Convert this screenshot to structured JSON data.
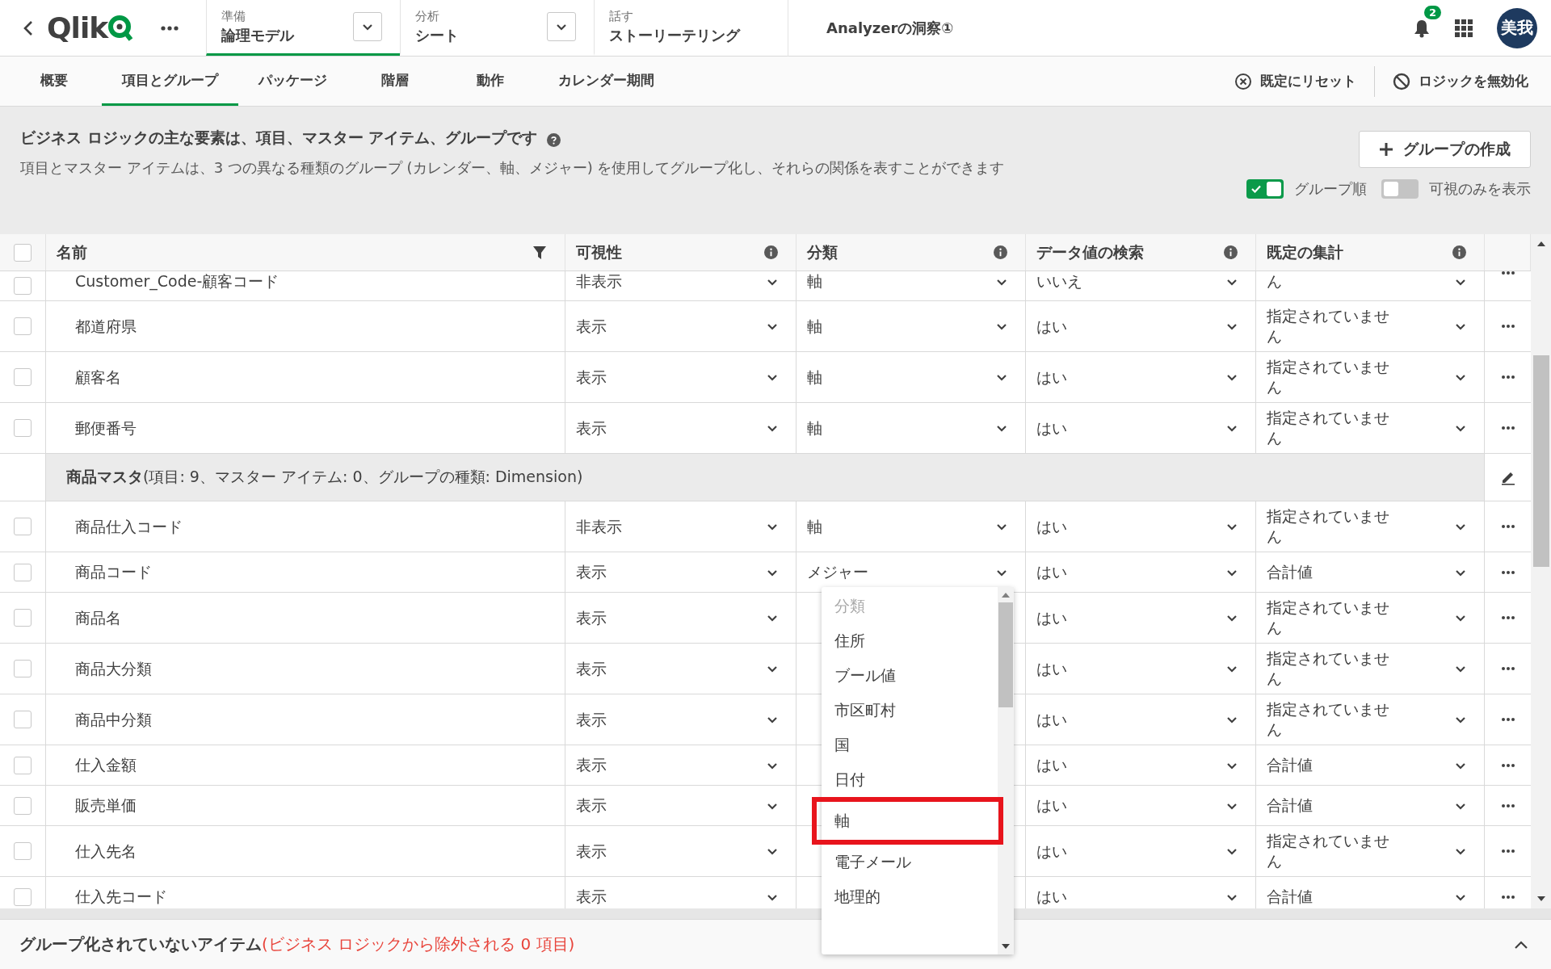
{
  "topbar": {
    "logo": "Qlik",
    "nav": [
      {
        "label": "準備",
        "value": "論理モデル",
        "selected": true,
        "has_dropdown": true
      },
      {
        "label": "分析",
        "value": "シート",
        "selected": false,
        "has_dropdown": true
      },
      {
        "label": "話す",
        "value": "ストーリーテリング",
        "selected": false,
        "has_dropdown": false
      }
    ],
    "app_title": "Analyzerの洞察①",
    "notification_count": "2",
    "avatar": "美我"
  },
  "tabs": [
    {
      "label": "概要",
      "selected": false
    },
    {
      "label": "項目とグループ",
      "selected": true
    },
    {
      "label": "パッケージ",
      "selected": false
    },
    {
      "label": "階層",
      "selected": false
    },
    {
      "label": "動作",
      "selected": false
    },
    {
      "label": "カレンダー期間",
      "selected": false
    }
  ],
  "actions": [
    {
      "label": "既定にリセット",
      "kind": "reset"
    },
    {
      "label": "ロジックを無効化",
      "kind": "disable"
    }
  ],
  "intro": {
    "heading": "ビジネス ロジックの主な要素は、項目、マスター アイテム、グループです",
    "description": "項目とマスター アイテムは、3 つの異なる種類のグループ (カレンダー、軸、メジャー) を使用してグループ化し、それらの関係を表すことができます"
  },
  "create_group_button": "グループの作成",
  "toggles": [
    {
      "label": "グループ順",
      "on": true
    },
    {
      "label": "可視のみを表示",
      "on": false
    }
  ],
  "table": {
    "all_checked": false,
    "columns": [
      {
        "label": "名前",
        "kind": "filter"
      },
      {
        "label": "可視性",
        "kind": "info"
      },
      {
        "label": "分類",
        "kind": "info"
      },
      {
        "label": "データ値の検索",
        "kind": "info"
      },
      {
        "label": "既定の集計",
        "kind": "info"
      }
    ],
    "rows": [
      {
        "kind": "clipped",
        "checked": false,
        "name": "Customer_Code-顧客コード",
        "visibility": "非表示",
        "classification": "軸",
        "search": "いいえ",
        "aggregation": "ん"
      },
      {
        "kind": "item",
        "checked": false,
        "name": "都道府県",
        "visibility": "表示",
        "classification": "軸",
        "search": "はい",
        "aggregation": "指定されていません"
      },
      {
        "kind": "item",
        "checked": false,
        "name": "顧客名",
        "visibility": "表示",
        "classification": "軸",
        "search": "はい",
        "aggregation": "指定されていません"
      },
      {
        "kind": "item",
        "checked": false,
        "name": "郵便番号",
        "visibility": "表示",
        "classification": "軸",
        "search": "はい",
        "aggregation": "指定されていません"
      },
      {
        "kind": "group",
        "title": "**商品マスタ**(項目: 9、マスター アイテム: 0、グループの種類: Dimension)"
      },
      {
        "kind": "item",
        "checked": false,
        "name": "商品仕入コード",
        "visibility": "非表示",
        "classification": "軸",
        "search": "はい",
        "aggregation": "指定されていません"
      },
      {
        "kind": "item",
        "checked": false,
        "name": "商品コード",
        "visibility": "表示",
        "classification": "メジャー",
        "search": "はい",
        "aggregation": "合計値"
      },
      {
        "kind": "item",
        "checked": false,
        "name": "商品名",
        "visibility": "表示",
        "search": "はい",
        "aggregation": "指定されていません"
      },
      {
        "kind": "item",
        "checked": false,
        "name": "商品大分類",
        "visibility": "表示",
        "search": "はい",
        "aggregation": "指定されていません"
      },
      {
        "kind": "item",
        "checked": false,
        "name": "商品中分類",
        "visibility": "表示",
        "search": "はい",
        "aggregation": "指定されていません"
      },
      {
        "kind": "item",
        "checked": false,
        "name": "仕入金額",
        "visibility": "表示",
        "search": "はい",
        "aggregation": "合計値"
      },
      {
        "kind": "item",
        "checked": false,
        "name": "販売単価",
        "visibility": "表示",
        "search": "はい",
        "aggregation": "合計値"
      },
      {
        "kind": "item",
        "checked": false,
        "name": "仕入先名",
        "visibility": "表示",
        "search": "はい",
        "aggregation": "指定されていません"
      },
      {
        "kind": "item",
        "checked": false,
        "name": "仕入先コード",
        "visibility": "表示",
        "search": "はい",
        "aggregation": "合計値"
      }
    ]
  },
  "dropdown": {
    "header": "分類",
    "options": [
      {
        "label": "住所",
        "highlighted": false
      },
      {
        "label": "ブール値",
        "highlighted": false
      },
      {
        "label": "市区町村",
        "highlighted": false
      },
      {
        "label": "国",
        "highlighted": false
      },
      {
        "label": "日付",
        "highlighted": false
      },
      {
        "label": "軸",
        "highlighted": true
      },
      {
        "label": "電子メール",
        "highlighted": false
      },
      {
        "label": "地理的",
        "highlighted": false
      }
    ]
  },
  "footer": {
    "title": "グループ化されていないアイテム",
    "note": "(ビジネス ロジックから除外される 0 項目)"
  }
}
